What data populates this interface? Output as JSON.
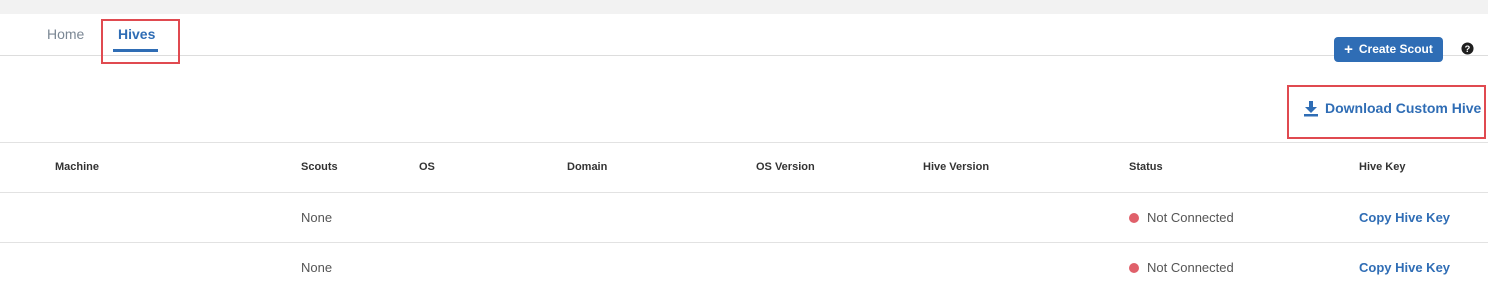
{
  "nav": {
    "tabs": [
      {
        "label": "Home",
        "active": false
      },
      {
        "label": "Hives",
        "active": true
      }
    ],
    "create_button": {
      "icon": "plus-icon",
      "label": "Create Scout"
    },
    "help_icon": "question-circle-icon"
  },
  "toolbar": {
    "download": {
      "icon": "download-icon",
      "label": "Download Custom Hive"
    }
  },
  "table": {
    "columns": [
      "Machine",
      "Scouts",
      "OS",
      "Domain",
      "OS Version",
      "Hive Version",
      "Status",
      "Hive Key"
    ],
    "rows": [
      {
        "machine": "",
        "scouts": "None",
        "os": "",
        "domain": "",
        "os_version": "",
        "hive_version": "",
        "status": "Not Connected",
        "hive_key_action": "Copy Hive Key"
      },
      {
        "machine": "",
        "scouts": "None",
        "os": "",
        "domain": "",
        "os_version": "",
        "hive_version": "",
        "status": "Not Connected",
        "hive_key_action": "Copy Hive Key"
      }
    ]
  },
  "colors": {
    "accent": "#2f6db5",
    "status_disconnected": "#e0606a",
    "highlight_border": "#e04a50"
  }
}
